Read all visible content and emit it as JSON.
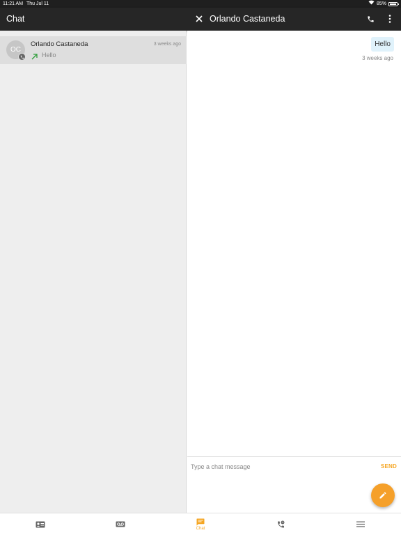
{
  "status_bar": {
    "time": "11:21 AM",
    "date": "Thu Jul 11",
    "battery_text": "85%",
    "battery_level": 0.85
  },
  "app_bar": {
    "left_title": "Chat",
    "conversation_title": "Orlando Castaneda"
  },
  "conversations": [
    {
      "initials": "OC",
      "name": "Orlando Castaneda",
      "time": "3 weeks ago",
      "preview": "Hello"
    }
  ],
  "messages": [
    {
      "text": "Hello",
      "time": "3 weeks ago",
      "direction": "outgoing"
    }
  ],
  "compose": {
    "placeholder": "Type a chat message",
    "send_label": "SEND"
  },
  "bottom_nav": {
    "tabs": [
      {
        "icon": "contacts-icon",
        "label": ""
      },
      {
        "icon": "voicemail-icon",
        "label": ""
      },
      {
        "icon": "chat-icon",
        "label": "Chat",
        "active": true
      },
      {
        "icon": "call-history-icon",
        "label": ""
      },
      {
        "icon": "menu-icon",
        "label": ""
      }
    ]
  },
  "colors": {
    "accent": "#f5a623",
    "app_bar": "#262626",
    "bubble": "#e0f2fb",
    "outgoing_arrow": "#2e9e3a"
  }
}
